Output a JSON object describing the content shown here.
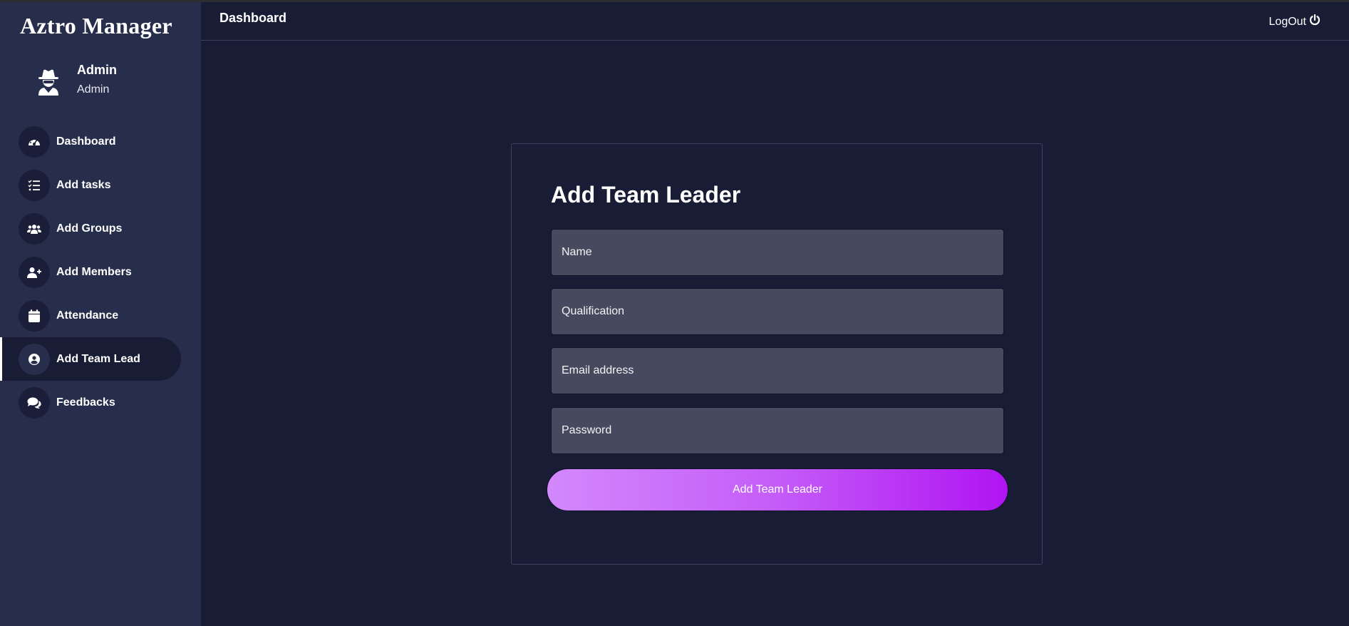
{
  "app": {
    "title": "Aztro Manager"
  },
  "profile": {
    "name": "Admin",
    "role": "Admin",
    "icon": "user-secret-icon"
  },
  "sidebar": {
    "items": [
      {
        "label": "Dashboard",
        "icon": "gauge-icon"
      },
      {
        "label": "Add tasks",
        "icon": "task-list-icon"
      },
      {
        "label": "Add Groups",
        "icon": "users-icon"
      },
      {
        "label": "Add Members",
        "icon": "user-plus-icon"
      },
      {
        "label": "Attendance",
        "icon": "calendar-icon"
      },
      {
        "label": "Add Team Lead",
        "icon": "user-circle-icon",
        "active": true
      },
      {
        "label": "Feedbacks",
        "icon": "comments-icon"
      }
    ]
  },
  "header": {
    "title": "Dashboard",
    "logout_label": "LogOut",
    "logout_icon": "power-icon"
  },
  "form": {
    "title": "Add Team Leader",
    "name_placeholder": "Name",
    "qualification_placeholder": "Qualification",
    "email_placeholder": "Email address",
    "password_placeholder": "Password",
    "submit_label": "Add Team Leader"
  },
  "colors": {
    "background": "#191c35",
    "sidebar": "#262e4c",
    "input": "#474a5e",
    "button_gradient_start": "#d388fc",
    "button_gradient_end": "#b014f2"
  }
}
